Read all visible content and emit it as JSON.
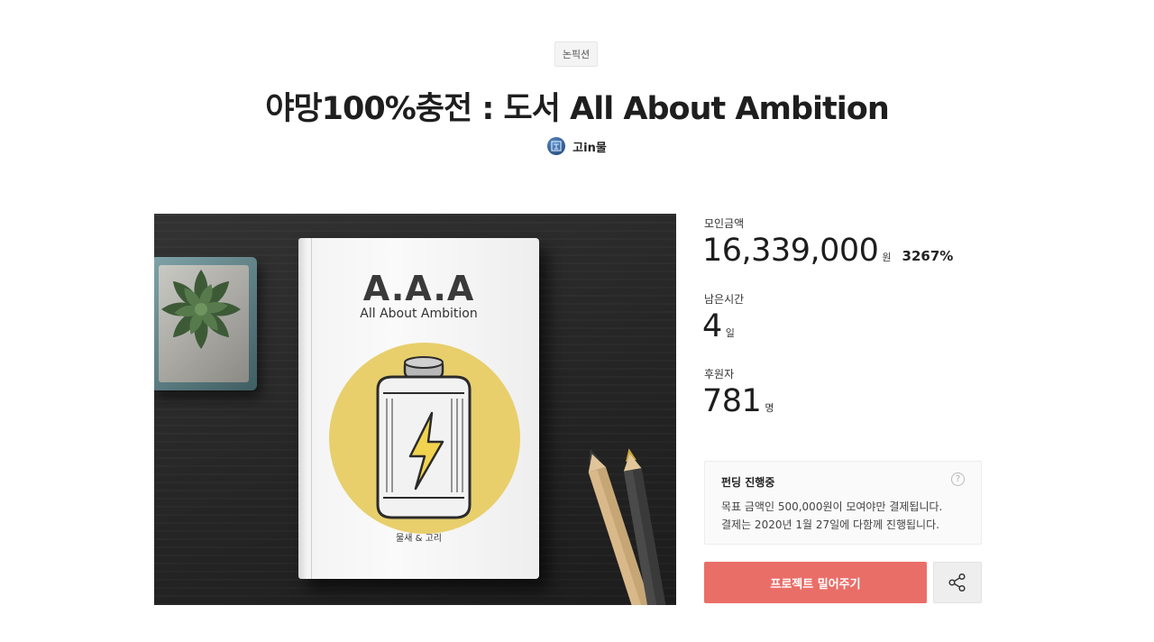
{
  "category": "논픽션",
  "title": "야망100%충전 : 도서 All About Ambition",
  "creator": {
    "name": "고in물",
    "avatar_icon": "avatar-image"
  },
  "hero_image": {
    "book_title": "A.A.A",
    "book_subtitle": "All About Ambition",
    "book_authors": "물새 & 고리",
    "circle_color": "#e8cf6c"
  },
  "stats": {
    "raised_label": "모인금액",
    "raised_value": "16,339,000",
    "raised_unit": "원",
    "raised_percent": "3267%",
    "time_label": "남은시간",
    "time_value": "4",
    "time_unit": "일",
    "backers_label": "후원자",
    "backers_value": "781",
    "backers_unit": "명"
  },
  "notice": {
    "title": "펀딩 진행중",
    "line1": "목표 금액인 500,000원이 모여야만 결제됩니다.",
    "line2": "결제는 2020년 1월 27일에 다함께 진행됩니다.",
    "help_icon": "?"
  },
  "actions": {
    "support_label": "프로젝트 밀어주기",
    "share_icon": "share-icon"
  },
  "colors": {
    "accent": "#ea6e68",
    "text": "#1d1d1d"
  }
}
